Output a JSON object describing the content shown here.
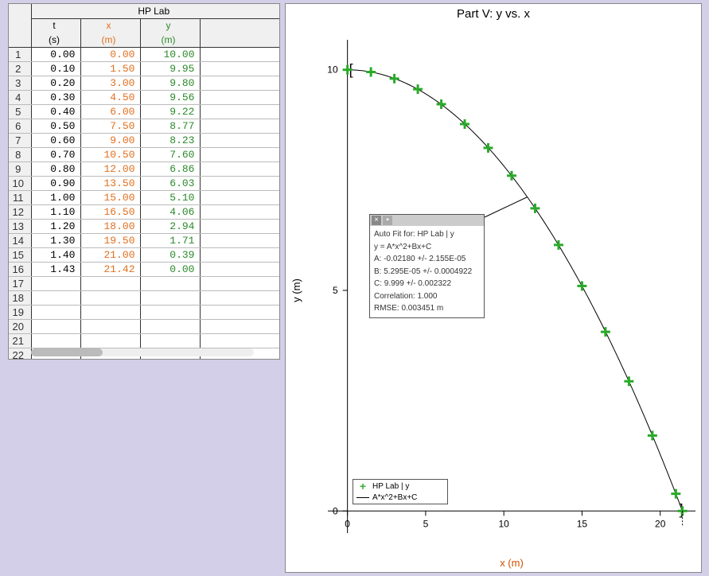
{
  "table": {
    "title": "HP Lab",
    "columns": [
      {
        "name": "t",
        "unit": "(s)"
      },
      {
        "name": "x",
        "unit": "(m)"
      },
      {
        "name": "y",
        "unit": "(m)"
      }
    ],
    "rows": [
      {
        "t": "0.00",
        "x": "0.00",
        "y": "10.00"
      },
      {
        "t": "0.10",
        "x": "1.50",
        "y": "9.95"
      },
      {
        "t": "0.20",
        "x": "3.00",
        "y": "9.80"
      },
      {
        "t": "0.30",
        "x": "4.50",
        "y": "9.56"
      },
      {
        "t": "0.40",
        "x": "6.00",
        "y": "9.22"
      },
      {
        "t": "0.50",
        "x": "7.50",
        "y": "8.77"
      },
      {
        "t": "0.60",
        "x": "9.00",
        "y": "8.23"
      },
      {
        "t": "0.70",
        "x": "10.50",
        "y": "7.60"
      },
      {
        "t": "0.80",
        "x": "12.00",
        "y": "6.86"
      },
      {
        "t": "0.90",
        "x": "13.50",
        "y": "6.03"
      },
      {
        "t": "1.00",
        "x": "15.00",
        "y": "5.10"
      },
      {
        "t": "1.10",
        "x": "16.50",
        "y": "4.06"
      },
      {
        "t": "1.20",
        "x": "18.00",
        "y": "2.94"
      },
      {
        "t": "1.30",
        "x": "19.50",
        "y": "1.71"
      },
      {
        "t": "1.40",
        "x": "21.00",
        "y": "0.39"
      },
      {
        "t": "1.43",
        "x": "21.42",
        "y": "0.00"
      }
    ],
    "blank_rows_after": 6
  },
  "chart": {
    "title": "Part V: y vs. x",
    "xlabel": "x (m)",
    "ylabel": "y (m)",
    "xticks": [
      0,
      5,
      10,
      15,
      20
    ],
    "yticks": [
      0,
      5,
      10
    ]
  },
  "fit": {
    "title": "Auto Fit for: HP Lab | y",
    "equation": "y = A*x^2+Bx+C",
    "A": "A: -0.02180 +/- 2.155E-05",
    "B": "B: 5.295E-05 +/- 0.0004922",
    "C": "C: 9.999 +/- 0.002322",
    "corr": "Correlation: 1.000",
    "rmse": "RMSE: 0.003451 m"
  },
  "legend": {
    "series_label": "HP Lab | y",
    "fit_label": "A*x^2+Bx+C"
  },
  "chart_data": {
    "type": "scatter",
    "title": "Part V: y vs. x",
    "xlabel": "x (m)",
    "ylabel": "y (m)",
    "xlim": [
      -1,
      22
    ],
    "ylim": [
      -0.5,
      10.5
    ],
    "series": [
      {
        "name": "HP Lab | y",
        "x": [
          0.0,
          1.5,
          3.0,
          4.5,
          6.0,
          7.5,
          9.0,
          10.5,
          12.0,
          13.5,
          15.0,
          16.5,
          18.0,
          19.5,
          21.0,
          21.42
        ],
        "y": [
          10.0,
          9.95,
          9.8,
          9.56,
          9.22,
          8.77,
          8.23,
          7.6,
          6.86,
          6.03,
          5.1,
          4.06,
          2.94,
          1.71,
          0.39,
          0.0
        ]
      }
    ],
    "fit": {
      "label": "A*x^2+Bx+C",
      "A": -0.0218,
      "B": 5.295e-05,
      "C": 9.999
    }
  }
}
